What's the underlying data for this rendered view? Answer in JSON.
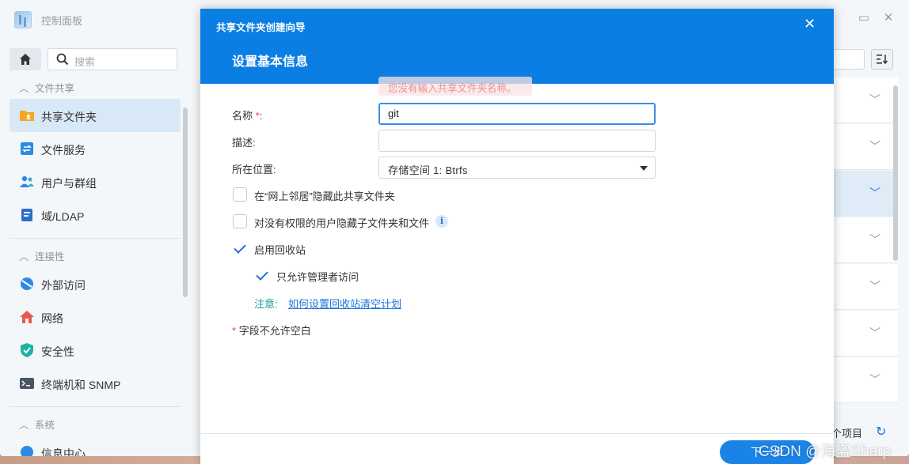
{
  "control_panel": {
    "title": "控制面板",
    "search_placeholder": "搜索",
    "sections": [
      {
        "label": "文件共享",
        "items": [
          "共享文件夹",
          "文件服务",
          "用户与群组",
          "域/LDAP"
        ]
      },
      {
        "label": "连接性",
        "items": [
          "外部访问",
          "网络",
          "安全性",
          "终端机和 SNMP"
        ]
      },
      {
        "label": "系统",
        "items": [
          "信息中心"
        ]
      }
    ],
    "active_item": "共享文件夹",
    "footer_text": "个项目"
  },
  "wizard": {
    "app_title": "共享文件夹创建向导",
    "step_title": "设置基本信息",
    "tooltip": "您没有输入共享文件夹名称。",
    "name_label": "名称",
    "name_required_mark": "*",
    "name_colon": ":",
    "name_value": "git",
    "description_label": "描述:",
    "description_value": "",
    "location_label": "所在位置:",
    "location_value": "存储空间 1:  Btrfs",
    "checkboxes": [
      {
        "label": "在“网上邻居”隐藏此共享文件夹",
        "checked": false
      },
      {
        "label": "对没有权限的用户隐藏子文件夹和文件",
        "checked": false
      },
      {
        "label": "启用回收站",
        "checked": true
      },
      {
        "label": "只允许管理者访问",
        "checked": true
      }
    ],
    "note_label": "注意:",
    "note_link": "如何设置回收站清空计划",
    "footnote_mark": "*",
    "footnote": "字段不允许空白",
    "next_button": "下一步"
  },
  "watermark": "CSDN @海盗Sharp",
  "colors": {
    "accent": "#0a7ee3",
    "required": "#e2413a",
    "note": "#1a9aa4"
  }
}
